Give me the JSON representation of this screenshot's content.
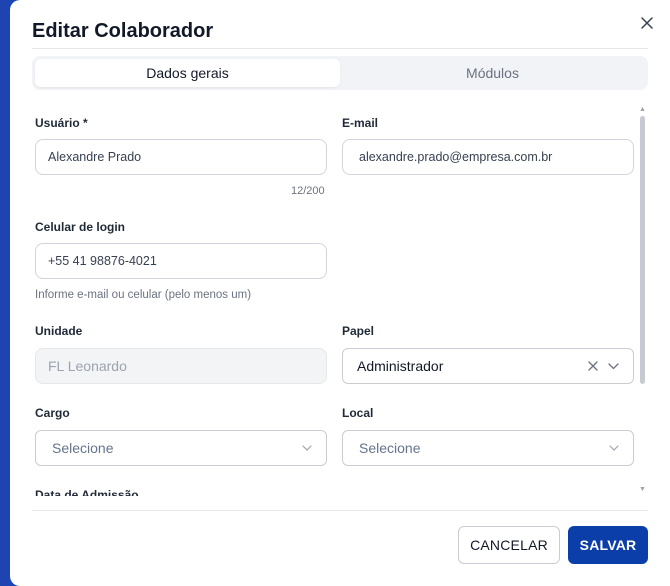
{
  "dialog": {
    "title": "Editar Colaborador",
    "tabs": [
      {
        "label": "Dados gerais",
        "active": true
      },
      {
        "label": "Módulos",
        "active": false
      }
    ]
  },
  "form": {
    "usuario": {
      "label": "Usuário *",
      "value": "Alexandre Prado",
      "counter": "12/200"
    },
    "email": {
      "label": "E-mail",
      "value": "alexandre.prado@empresa.com.br"
    },
    "celular": {
      "label": "Celular de login",
      "value": "+55 41 98876-4021",
      "hint": "Informe e-mail ou celular (pelo menos um)"
    },
    "unidade": {
      "label": "Unidade",
      "value": "FL Leonardo"
    },
    "papel": {
      "label": "Papel",
      "value": "Administrador"
    },
    "cargo": {
      "label": "Cargo",
      "placeholder": "Selecione"
    },
    "local": {
      "label": "Local",
      "placeholder": "Selecione"
    },
    "data_admissao": {
      "label": "Data de Admissão"
    }
  },
  "footer": {
    "cancel_label": "CANCELAR",
    "save_label": "SALVAR"
  },
  "colors": {
    "primary": "#0b3ea8",
    "backdrop": "#1a46b8"
  }
}
